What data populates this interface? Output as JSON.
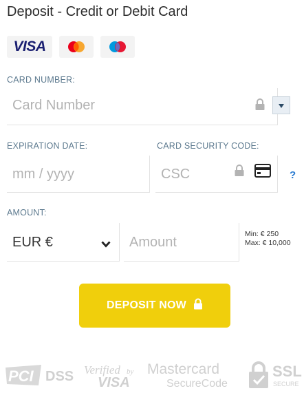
{
  "title": "Deposit - Credit or Debit Card",
  "card_logos": {
    "visa": "VISA",
    "mastercard_icon": "mastercard-icon",
    "maestro_icon": "maestro-icon"
  },
  "card_number": {
    "label": "CARD NUMBER:",
    "placeholder": "Card Number"
  },
  "expiration": {
    "label": "EXPIRATION DATE:",
    "placeholder": "mm / yyyy"
  },
  "security_code": {
    "label": "CARD SECURITY CODE:",
    "placeholder": "CSC",
    "help": "?"
  },
  "amount": {
    "label": "AMOUNT:",
    "currency": "EUR €",
    "placeholder": "Amount",
    "min": "Min: € 250",
    "max": "Max: € 10,000"
  },
  "deposit_button": {
    "label": "DEPOSIT NOW"
  },
  "trust_badges": {
    "pci": "PCI",
    "dss": "DSS",
    "verified_by": "Verified",
    "by": "by",
    "visa": "VISA",
    "mastercard": "Mastercard",
    "securecode": "SecureCode",
    "ssl": "SSL",
    "secure": "SECURE"
  },
  "colors": {
    "accent": "#f0cf0c",
    "label": "#5d7a8f",
    "help": "#2a7bd1"
  }
}
